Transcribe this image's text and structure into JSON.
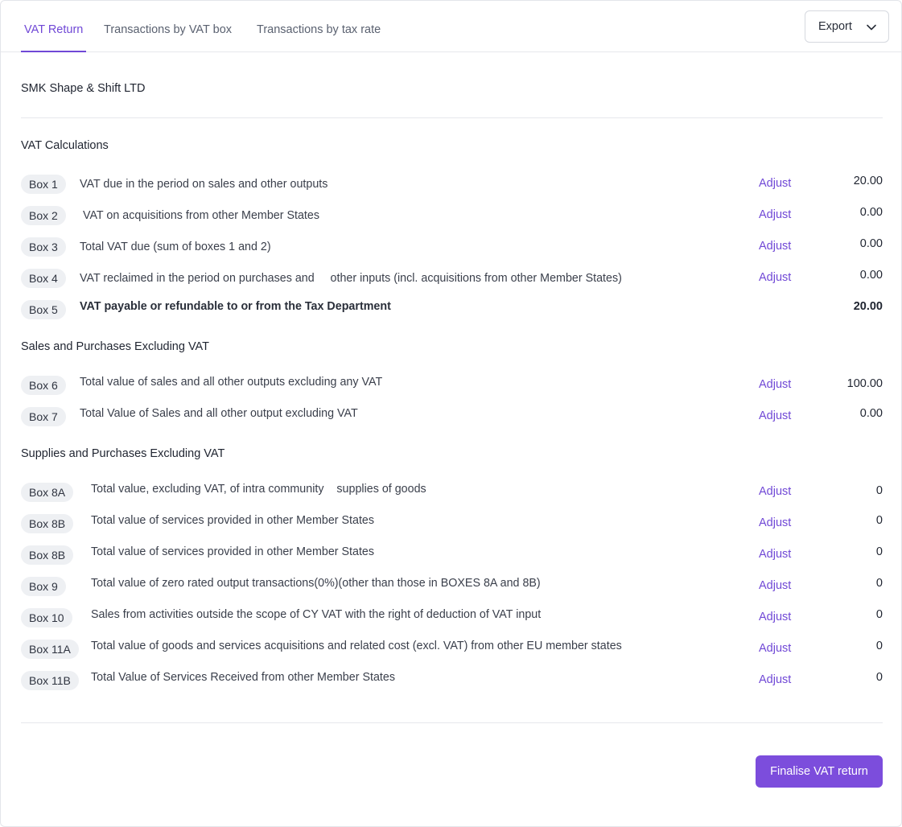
{
  "tabs": [
    {
      "label": "VAT Return",
      "active": true
    },
    {
      "label": "Transactions by VAT box",
      "active": false
    },
    {
      "label": "Transactions by tax rate",
      "active": false
    }
  ],
  "export": {
    "label": "Export",
    "icon": "chevron-down-icon"
  },
  "company_name": "SMK Shape & Shift LTD",
  "sections": {
    "vat_calculations": {
      "title": "VAT Calculations",
      "rows": [
        {
          "box": "Box 1",
          "description": "VAT due in the period on sales and other outputs",
          "adjust": "Adjust",
          "amount": "20.00"
        },
        {
          "box": "Box 2",
          "description": " VAT on acquisitions from other Member States",
          "adjust": "Adjust",
          "amount": "0.00"
        },
        {
          "box": "Box 3",
          "description": "Total VAT due (sum of boxes 1 and 2)",
          "adjust": "Adjust",
          "amount": "0.00"
        },
        {
          "box": "Box 4",
          "description": "VAT reclaimed in the period on purchases and     other inputs (incl. acquisitions from other Member States)",
          "adjust": "Adjust",
          "amount": "0.00"
        },
        {
          "box": "Box 5",
          "description": "VAT payable or refundable to or from the Tax Department",
          "adjust": "",
          "amount": "20.00"
        }
      ]
    },
    "sales_purchases": {
      "title": "Sales and Purchases Excluding VAT",
      "rows": [
        {
          "box": "Box 6",
          "description": "Total value of sales and all other outputs excluding any VAT",
          "adjust": "Adjust",
          "amount": "100.00"
        },
        {
          "box": "Box 7",
          "description": "Total Value of Sales and all other output excluding VAT",
          "adjust": "Adjust",
          "amount": "0.00"
        }
      ]
    },
    "supplies_purchases": {
      "title": "Supplies and Purchases Excluding VAT",
      "rows": [
        {
          "box": "Box 8A",
          "description": "Total value, excluding VAT, of intra community    supplies of goods",
          "adjust": "Adjust",
          "amount": "0"
        },
        {
          "box": "Box 8B",
          "description": "Total value of services provided in other Member States",
          "adjust": "Adjust",
          "amount": "0"
        },
        {
          "box": "Box 8B",
          "description": "Total value of services provided in other Member States",
          "adjust": "Adjust",
          "amount": "0"
        },
        {
          "box": "Box 9",
          "description": "Total value of zero rated output transactions(0%)(other than those in BOXES 8A and 8B)",
          "adjust": "Adjust",
          "amount": "0"
        },
        {
          "box": "Box 10",
          "description": "Sales from activities outside the scope of CY VAT with the right of deduction of VAT input",
          "adjust": "Adjust",
          "amount": "0"
        },
        {
          "box": "Box 11A",
          "description": "Total value of goods and services acquisitions and related cost (excl. VAT) from other EU member states",
          "adjust": "Adjust",
          "amount": "0"
        },
        {
          "box": "Box 11B",
          "description": "Total Value of Services Received from other Member States",
          "adjust": "Adjust",
          "amount": "0"
        }
      ]
    }
  },
  "finalise": {
    "label": "Finalise VAT return"
  },
  "colors": {
    "accent": "#7048d6",
    "button": "#7c4ddc",
    "pill": "#eef0f3"
  }
}
